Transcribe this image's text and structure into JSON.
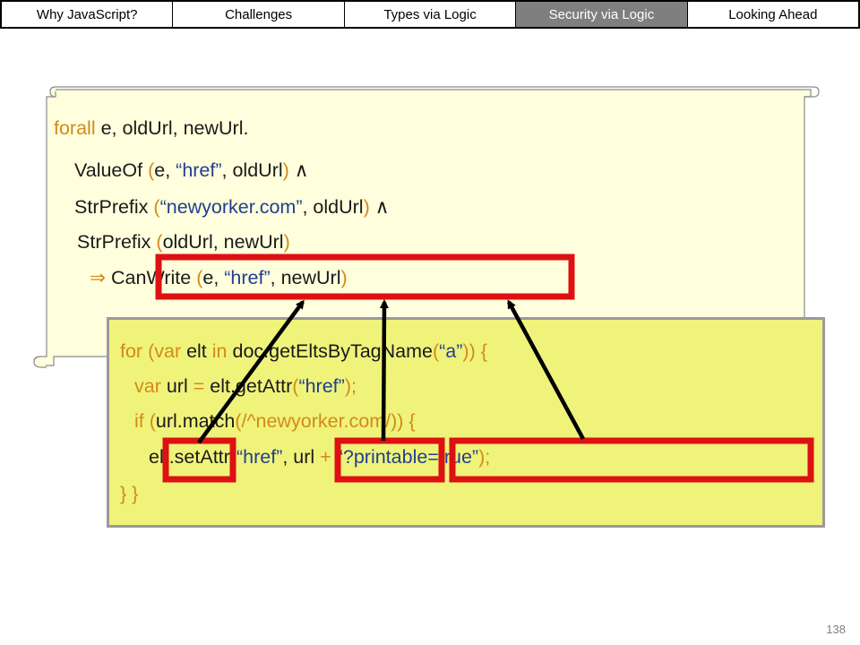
{
  "nav": {
    "tabs": [
      {
        "label": "Why JavaScript?",
        "active": false
      },
      {
        "label": "Challenges",
        "active": false
      },
      {
        "label": "Types via Logic",
        "active": false
      },
      {
        "label": "Security via Logic",
        "active": true
      },
      {
        "label": "Looking Ahead",
        "active": false
      }
    ]
  },
  "formula": {
    "l1": {
      "a": "forall",
      "b": " e, oldUrl, newUrl."
    },
    "l2": {
      "a": "ValueOf ",
      "b": "(",
      "c": "e, ",
      "d": "“href”",
      "e": ", oldUrl",
      "f": ")",
      "g": " ∧"
    },
    "l3": {
      "a": "StrPrefix ",
      "b": "(",
      "c": "“newyorker.com”",
      "d": ", oldUrl",
      "e": ")",
      "f": " ∧"
    },
    "l4": {
      "a": "StrPrefix ",
      "b": "(",
      "c": "oldUrl, newUrl",
      "d": ")"
    },
    "l5": {
      "a": "⇒ ",
      "b": "CanWrite ",
      "c": "(",
      "d": "e, ",
      "e": "“href”",
      "f": ", newUrl",
      "g": ")"
    }
  },
  "code": {
    "l1": {
      "a": "for ",
      "b": "(var ",
      "c": "elt ",
      "d": "in ",
      "e": "doc.getEltsByTagName",
      "f": "(",
      "g": "“a”",
      "h": ")) {"
    },
    "l2": {
      "a": "var ",
      "b": "url ",
      "c": "= ",
      "d": "elt.getAttr",
      "e": "(",
      "f": "“href”",
      "g": ");"
    },
    "l3": {
      "a": "if ",
      "b": "(",
      "c": "url.match",
      "d": "(/^newyorker.com/)) {"
    },
    "l4": {
      "a": "elt.setAttr",
      "b": "(",
      "c": "“href”",
      "d": ", url ",
      "e": "+ ",
      "f": "“?printable=true”",
      "g": ");"
    },
    "l5": {
      "a": "} }"
    }
  },
  "colors": {
    "keyword": "#d28a1a",
    "string": "#1f3f8f",
    "highlight": "#dd1111",
    "panel": "#f0f37a",
    "scroll": "#ffffdd"
  },
  "page_number": "138"
}
